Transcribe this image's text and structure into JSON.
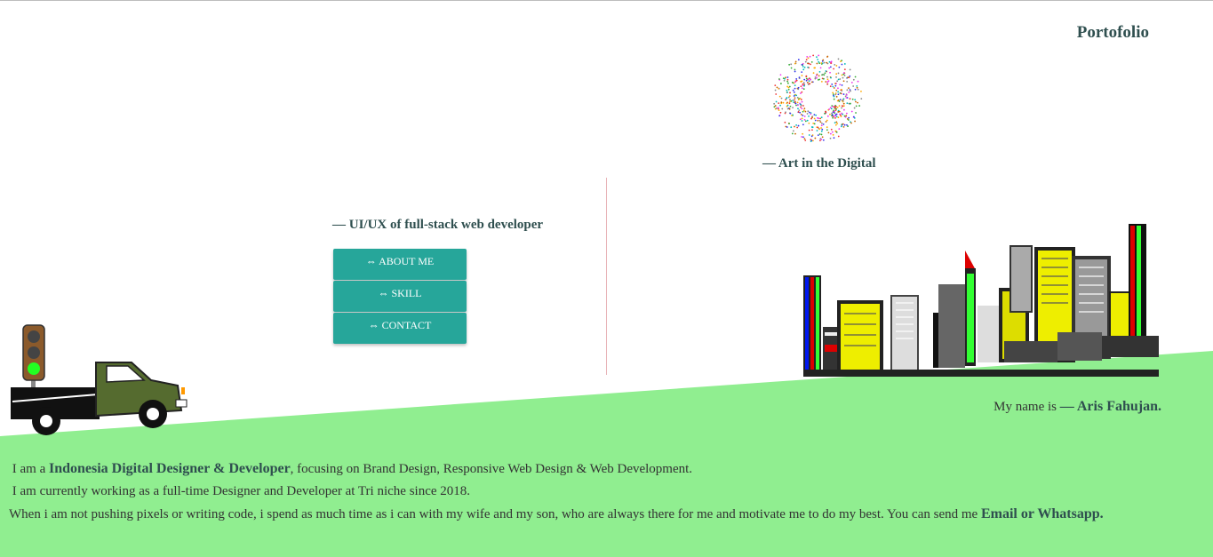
{
  "header": {
    "brand": "Portofolio"
  },
  "hero": {
    "art_caption": "— Art in the Digital",
    "tagline": "— UI/UX of full-stack web developer"
  },
  "menu": {
    "items": [
      {
        "label": "⇔ ABOUT ME"
      },
      {
        "label": "⇔ SKILL"
      },
      {
        "label": "⇔ CONTACT"
      }
    ]
  },
  "intro": {
    "prefix": "My name is ",
    "name": "— Aris Fahujan."
  },
  "bio": {
    "line1_pre": "I am a ",
    "line1_bold": "Indonesia Digital Designer & Developer",
    "line1_post": ", focusing on Brand Design, Responsive Web Design & Web Development.",
    "line2": "I am currently working as a full-time Designer and Developer at Tri niche since 2018.",
    "line3_pre": "When i am not pushing pixels or writing code, i spend as much time as i can with my wife and my son, who are always there for me and motivate me to do my best. You can send me ",
    "line3_bold": "Email or Whatsapp."
  },
  "colors": {
    "accent": "#26a69a",
    "ground": "#90ee90",
    "heading": "#2f4f4f",
    "divider": "#e8b4b8"
  },
  "icons": [
    "traffic-light-icon",
    "truck-icon",
    "city-skyline-icon",
    "dot-circle-icon"
  ]
}
